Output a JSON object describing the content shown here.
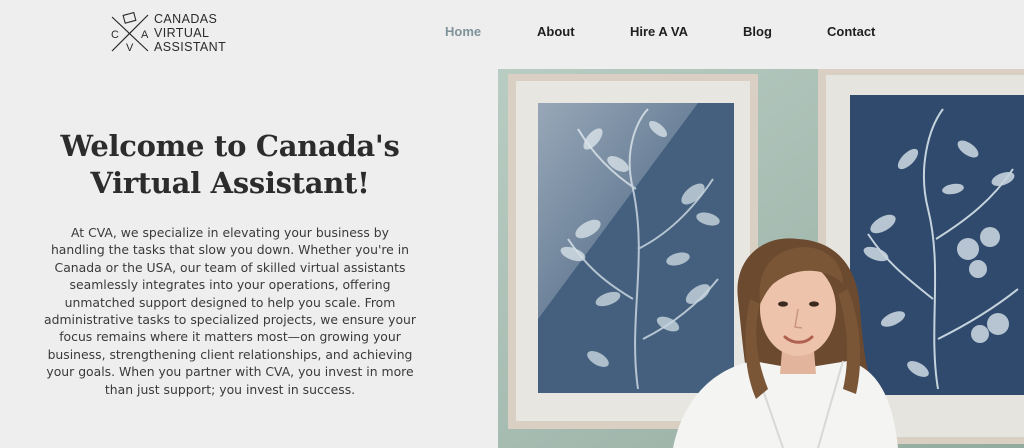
{
  "brand": {
    "logo_letters": [
      "C",
      "V",
      "A"
    ],
    "name_lines": [
      "CANADAS",
      "VIRTUAL",
      "ASSISTANT"
    ]
  },
  "nav": {
    "items": [
      {
        "label": "Home",
        "active": true
      },
      {
        "label": "About",
        "active": false
      },
      {
        "label": "Hire A VA",
        "active": false
      },
      {
        "label": "Blog",
        "active": false
      },
      {
        "label": "Contact",
        "active": false
      }
    ],
    "active_color": "#7f9399",
    "color": "#1f1f1f"
  },
  "hero": {
    "headline_line1": "Welcome to Canada's",
    "headline_line2": "Virtual Assistant!",
    "paragraph1": "At CVA, we specialize in elevating your business by handling the tasks that slow you down. Whether you're in Canada or the USA, our team of skilled virtual assistants seamlessly integrates into your operations, offering unmatched support designed to help you scale.",
    "paragraph2": "From administrative tasks to specialized projects, we ensure your focus remains where it matters most—on growing your business, strengthening client relationships, and achieving your goals. When you partner with CVA, you invest in more than just support; you invest in success."
  },
  "colors": {
    "page_background": "#eeeeee",
    "wall": "#a7bcb3",
    "print_blue": "#3d5778"
  }
}
